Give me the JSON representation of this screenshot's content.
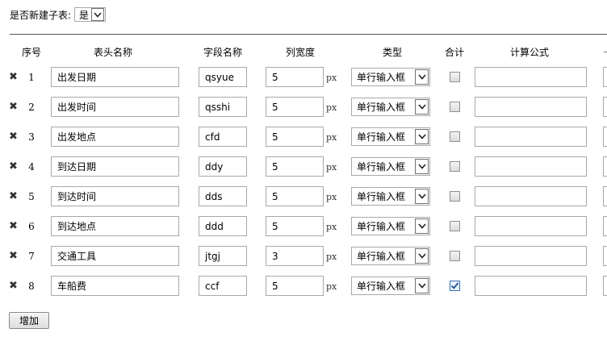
{
  "subtable": {
    "label": "是否新建子表:",
    "value": "是"
  },
  "headers": {
    "seq": "序号",
    "title": "表头名称",
    "field": "字段名称",
    "width": "列宽度",
    "type": "类型",
    "sum": "合计",
    "formula": "计算公式"
  },
  "unit": "px",
  "delete_icon": "close-icon",
  "rows": [
    {
      "num": "1",
      "title": "出发日期",
      "field": "qsyue",
      "width": "5",
      "type": "单行输入框",
      "sum": false,
      "formula": ""
    },
    {
      "num": "2",
      "title": "出发时间",
      "field": "qsshi",
      "width": "5",
      "type": "单行输入框",
      "sum": false,
      "formula": ""
    },
    {
      "num": "3",
      "title": "出发地点",
      "field": "cfd",
      "width": "5",
      "type": "单行输入框",
      "sum": false,
      "formula": ""
    },
    {
      "num": "4",
      "title": "到达日期",
      "field": "ddy",
      "width": "5",
      "type": "单行输入框",
      "sum": false,
      "formula": ""
    },
    {
      "num": "5",
      "title": "到达时间",
      "field": "dds",
      "width": "5",
      "type": "单行输入框",
      "sum": false,
      "formula": ""
    },
    {
      "num": "6",
      "title": "到达地点",
      "field": "ddd",
      "width": "5",
      "type": "单行输入框",
      "sum": false,
      "formula": ""
    },
    {
      "num": "7",
      "title": "交通工具",
      "field": "jtgj",
      "width": "3",
      "type": "单行输入框",
      "sum": false,
      "formula": ""
    },
    {
      "num": "8",
      "title": "车船费",
      "field": "ccf",
      "width": "5",
      "type": "单行输入框",
      "sum": true,
      "formula": ""
    }
  ],
  "add_button": "增加"
}
